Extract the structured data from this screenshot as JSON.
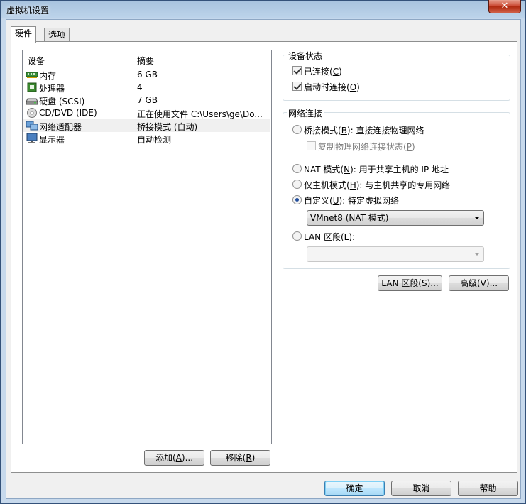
{
  "window": {
    "title": "虚拟机设置",
    "close_label": "✕"
  },
  "tabs": [
    {
      "label": "硬件"
    },
    {
      "label": "选项"
    }
  ],
  "device_list": {
    "header_device": "设备",
    "header_summary": "摘要",
    "rows": [
      {
        "name": "内存",
        "summary": "6 GB",
        "icon": "memory-icon"
      },
      {
        "name": "处理器",
        "summary": "4",
        "icon": "processor-icon"
      },
      {
        "name": "硬盘 (SCSI)",
        "summary": "7 GB",
        "icon": "hard-disk-icon"
      },
      {
        "name": "CD/DVD (IDE)",
        "summary": "正在使用文件 C:\\Users\\ge\\Do...",
        "icon": "cd-dvd-icon"
      },
      {
        "name": "网络适配器",
        "summary": "桥接模式 (自动)",
        "icon": "network-adapter-icon"
      },
      {
        "name": "显示器",
        "summary": "自动检测",
        "icon": "display-icon"
      }
    ]
  },
  "buttons": {
    "add": {
      "text": "添加(",
      "key": "A",
      "tail": ")..."
    },
    "remove": {
      "text": "移除(",
      "key": "R",
      "tail": ")"
    },
    "lan_segment": {
      "text": "LAN 区段(",
      "key": "S",
      "tail": ")..."
    },
    "advanced": {
      "text": "高级(",
      "key": "V",
      "tail": ")..."
    },
    "ok": "确定",
    "cancel": "取消",
    "help": "帮助"
  },
  "device_status": {
    "title": "设备状态",
    "connected": {
      "text": "已连接(",
      "key": "C",
      "tail": ")",
      "checked": true
    },
    "connect_at_power_on": {
      "text": "启动时连接(",
      "key": "O",
      "tail": ")",
      "checked": true
    }
  },
  "network": {
    "title": "网络连接",
    "bridged": {
      "text": "桥接模式(",
      "key": "B",
      "tail": "): 直接连接物理网络"
    },
    "replicate": {
      "text": "复制物理网络连接状态(",
      "key": "P",
      "tail": ")"
    },
    "nat": {
      "text": "NAT 模式(",
      "key": "N",
      "tail": "): 用于共享主机的 IP 地址"
    },
    "host_only": {
      "text": "仅主机模式(",
      "key": "H",
      "tail": "): 与主机共享的专用网络"
    },
    "custom": {
      "text": "自定义(",
      "key": "U",
      "tail": "): 特定虚拟网络"
    },
    "custom_select": "VMnet8 (NAT 模式)",
    "lan": {
      "text": "LAN 区段(",
      "key": "L",
      "tail": "):"
    },
    "lan_select": ""
  },
  "colors": {
    "titlebar": "#bcd3ea",
    "close": "#c8432c",
    "default_button_border": "#3c7fb1"
  }
}
